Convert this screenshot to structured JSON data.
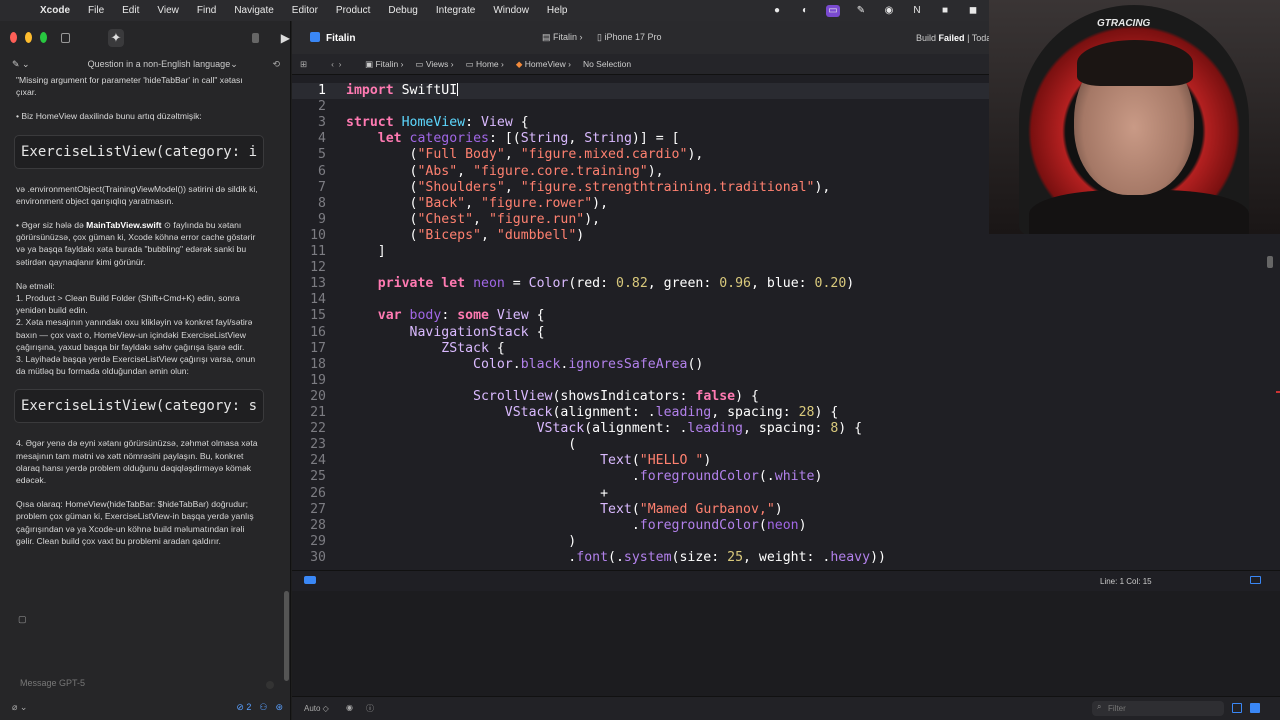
{
  "menubar": {
    "app_name": "Xcode",
    "items": [
      "File",
      "Edit",
      "View",
      "Find",
      "Navigate",
      "Editor",
      "Product",
      "Debug",
      "Integrate",
      "Window",
      "Help"
    ]
  },
  "sidebar": {
    "conversation_title": "Question in a non-English language",
    "chat": {
      "p1": "\"Missing argument for parameter 'hideTabBar' in call\" xətası çıxar.",
      "p2": "• Biz HomeView daxilində bunu artıq düzəltmişik:",
      "code1": "ExerciseListView(category: i",
      "p3": "və .environmentObject(TrainingViewModel()) sətirini də sildik ki, environment object qarışıqlıq yaratmasın.",
      "p4_pre": "• Əgər siz hələ də ",
      "p4_file": "MainTabView.swift",
      "p4_post": " faylında bu xətanı görürsünüzsə, çox güman ki, Xcode köhnə error cache göstərir və ya başqa fayldakı xəta burada \"bubbling\" edərək sanki bu sətirdən qaynaqlanır kimi görünür.",
      "p5_title": "Nə etməli:",
      "p5_1": "1. Product > Clean Build Folder (Shift+Cmd+K) edin, sonra yenidən build edin.",
      "p5_2": "2. Xəta mesajının yanındakı oxu klikləyin və konkret fayl/sətirə baxın — çox vaxt o, HomeView-un içindəki ExerciseListView çağırışına, yaxud başqa bir fayldakı səhv çağırışa işarə edir.",
      "p5_3": "3. Layihədə başqa yerdə ExerciseListView çağırışı varsa, onun da mütləq bu formada olduğundan əmin olun:",
      "code2": "ExerciseListView(category: s",
      "p6": "4. Əgər yenə də eyni xətanı görürsünüzsə, zəhmət olmasa xəta mesajının tam mətni və xətt nömrəsini paylaşın. Bu, konkret olaraq hansı yerdə problem olduğunu dəqiqləşdirməyə kömək edəcək.",
      "p7": "Qısa olaraq: HomeView(hideTabBar: $hideTabBar) doğrudur; problem çox güman ki, ExerciseListView-in başqa yerdə yanlış çağırışından və ya Xcode-un köhnə build məlumatından irəli gəlir. Clean build çox vaxt bu problemi aradan qaldırır."
    },
    "message_placeholder": "Message GPT-5",
    "badge_count": "2"
  },
  "toolbar": {
    "project": "Fitalin",
    "scheme": "Fitalin",
    "destination": "iPhone 17 Pro",
    "status_prefix": "Build",
    "status_value": "Failed",
    "status_suffix": "| Toda"
  },
  "jumpbar": {
    "crumbs": [
      "Fitalin",
      "Views",
      "Home",
      "HomeView",
      "No Selection"
    ]
  },
  "editor": {
    "lines": [
      {
        "n": "1",
        "html": "<span class=\"kw\">import</span> SwiftUI<span class=\"cursor-caret\"></span>"
      },
      {
        "n": "2",
        "html": ""
      },
      {
        "n": "3",
        "html": "<span class=\"kw\">struct</span> <span class=\"tyd\">HomeView</span>: <span class=\"ty\">View</span> {"
      },
      {
        "n": "4",
        "html": "    <span class=\"kw\">let</span> <span class=\"prop\">categories</span>: [(<span class=\"ty\">String</span>, <span class=\"ty\">String</span>)] = ["
      },
      {
        "n": "5",
        "html": "        (<span class=\"str\">\"Full Body\"</span>, <span class=\"str\">\"figure.mixed.cardio\"</span>),"
      },
      {
        "n": "6",
        "html": "        (<span class=\"str\">\"Abs\"</span>, <span class=\"str\">\"figure.core.training\"</span>),"
      },
      {
        "n": "7",
        "html": "        (<span class=\"str\">\"Shoulders\"</span>, <span class=\"str\">\"figure.strengthtraining.traditional\"</span>),"
      },
      {
        "n": "8",
        "html": "        (<span class=\"str\">\"Back\"</span>, <span class=\"str\">\"figure.rower\"</span>),"
      },
      {
        "n": "9",
        "html": "        (<span class=\"str\">\"Chest\"</span>, <span class=\"str\">\"figure.run\"</span>),"
      },
      {
        "n": "10",
        "html": "        (<span class=\"str\">\"Biceps\"</span>, <span class=\"str\">\"dumbbell\"</span>)"
      },
      {
        "n": "11",
        "html": "    ]"
      },
      {
        "n": "12",
        "html": ""
      },
      {
        "n": "13",
        "html": "    <span class=\"kw\">private let</span> <span class=\"prop\">neon</span> = <span class=\"ty\">Color</span>(red: <span class=\"num\">0.82</span>, green: <span class=\"num\">0.96</span>, blue: <span class=\"num\">0.20</span>)"
      },
      {
        "n": "14",
        "html": ""
      },
      {
        "n": "15",
        "html": "    <span class=\"kw\">var</span> <span class=\"prop\">body</span>: <span class=\"kw\">some</span> <span class=\"ty\">View</span> {"
      },
      {
        "n": "16",
        "html": "        <span class=\"ty\">NavigationStack</span> {"
      },
      {
        "n": "17",
        "html": "            <span class=\"ty\">ZStack</span> {"
      },
      {
        "n": "18",
        "html": "                <span class=\"ty\">Color</span>.<span class=\"fn\">black</span>.<span class=\"fn\">ignoresSafeArea</span>()"
      },
      {
        "n": "19",
        "html": ""
      },
      {
        "n": "20",
        "html": "                <span class=\"ty\">ScrollView</span>(showsIndicators: <span class=\"kw\">false</span>) {"
      },
      {
        "n": "21",
        "html": "                    <span class=\"ty\">VStack</span>(alignment: .<span class=\"fn\">leading</span>, spacing: <span class=\"num\">28</span>) {"
      },
      {
        "n": "22",
        "html": "                        <span class=\"ty\">VStack</span>(alignment: .<span class=\"fn\">leading</span>, spacing: <span class=\"num\">8</span>) {"
      },
      {
        "n": "23",
        "html": "                            ("
      },
      {
        "n": "24",
        "html": "                                <span class=\"ty\">Text</span>(<span class=\"str\">\"HELLO \"</span>)"
      },
      {
        "n": "25",
        "html": "                                    .<span class=\"fn\">foregroundColor</span>(.<span class=\"fn\">white</span>)"
      },
      {
        "n": "26",
        "html": "                                +"
      },
      {
        "n": "27",
        "html": "                                <span class=\"ty\">Text</span>(<span class=\"str\">\"Mamed Gurbanov,\"</span>)"
      },
      {
        "n": "28",
        "html": "                                    .<span class=\"fn\">foregroundColor</span>(<span class=\"prop\">neon</span>)"
      },
      {
        "n": "29",
        "html": "                            )"
      },
      {
        "n": "30",
        "html": "                            .<span class=\"fn\">font</span>(.<span class=\"fn\">system</span>(size: <span class=\"num\">25</span>, weight: .<span class=\"fn\">heavy</span>))"
      }
    ],
    "current_line": "1"
  },
  "status": {
    "line_col": "Line: 1  Col: 15"
  },
  "bottom": {
    "auto": "Auto ◇",
    "filter_placeholder": "Filter"
  },
  "webcam": {
    "brand": "GTRACING"
  }
}
